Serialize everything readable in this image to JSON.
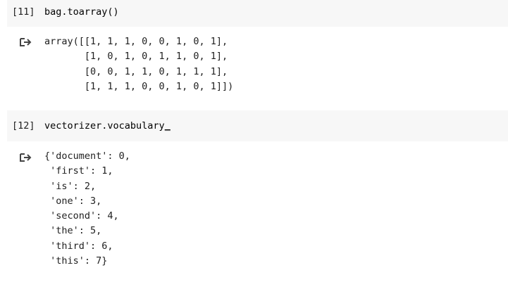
{
  "cells": [
    {
      "prompt": "[11]",
      "code": "bag.toarray()",
      "output_icon": "output-redirect-icon",
      "output": "array([[1, 1, 1, 0, 0, 1, 0, 1],\n       [1, 0, 1, 0, 1, 1, 0, 1],\n       [0, 0, 1, 1, 0, 1, 1, 1],\n       [1, 1, 1, 0, 0, 1, 0, 1]])"
    },
    {
      "prompt": "[12]",
      "code": "vectorizer.vocabulary",
      "code_cursor": "_",
      "output_icon": "output-redirect-icon",
      "output": "{'document': 0,\n 'first': 1,\n 'is': 2,\n 'one': 3,\n 'second': 4,\n 'the': 5,\n 'third': 6,\n 'this': 7}"
    }
  ],
  "colors": {
    "cell_background": "#f7f7f7",
    "text": "#212121",
    "icon": "#444444"
  }
}
